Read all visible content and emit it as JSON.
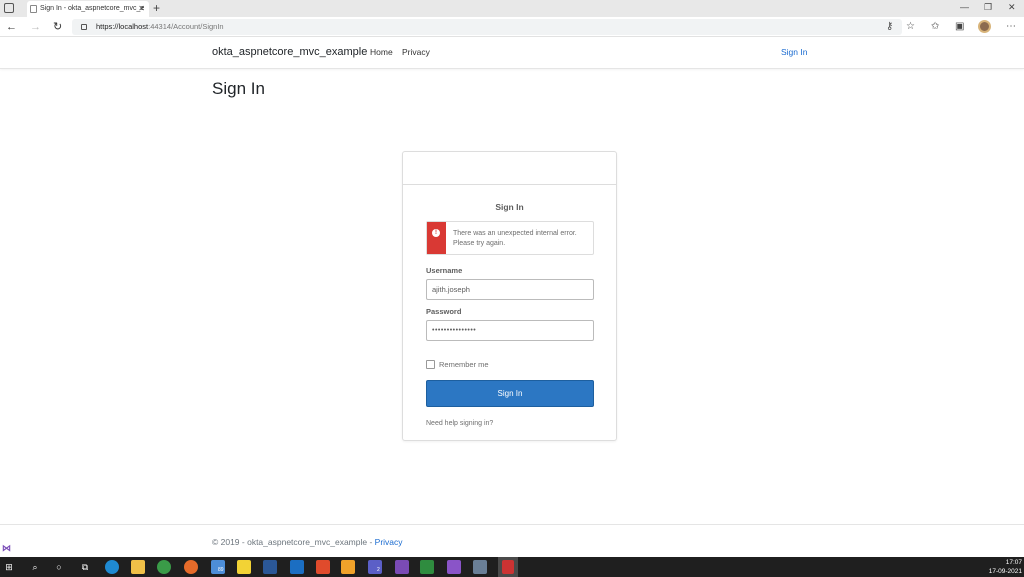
{
  "browser": {
    "tab_title": "Sign In - okta_aspnetcore_mvc_e",
    "new_tab": "+",
    "url_scheme_host": "https://localhost",
    "url_port_path": ":44314/Account/SignIn",
    "icons": [
      "tab-actions-icon",
      "back-icon",
      "forward-icon",
      "refresh-icon",
      "lock-icon",
      "key-icon",
      "favorite-add-icon",
      "favorites-icon",
      "collections-icon",
      "profile-icon",
      "more-icon"
    ]
  },
  "site_nav": {
    "brand": "okta_aspnetcore_mvc_example",
    "home": "Home",
    "privacy": "Privacy",
    "sign_in": "Sign In"
  },
  "page": {
    "title": "Sign In"
  },
  "widget": {
    "title": "Sign In",
    "error_icon": "!",
    "error_message": "There was an unexpected internal error. Please try again.",
    "username_label": "Username",
    "username_value": "ajith.joseph",
    "password_label": "Password",
    "password_value": "•••••••••••••••",
    "remember_label": "Remember me",
    "remember_checked": false,
    "submit_label": "Sign In",
    "help_link": "Need help signing in?",
    "colors": {
      "error": "#d93934",
      "button": "#2c77c3"
    }
  },
  "footer": {
    "text": "© 2019 - okta_aspnetcore_mvc_example - ",
    "privacy_link": "Privacy"
  },
  "taskbar": {
    "time": "17:07",
    "date": "17-09-2021",
    "badge_89": "89",
    "badge_2": "2"
  }
}
